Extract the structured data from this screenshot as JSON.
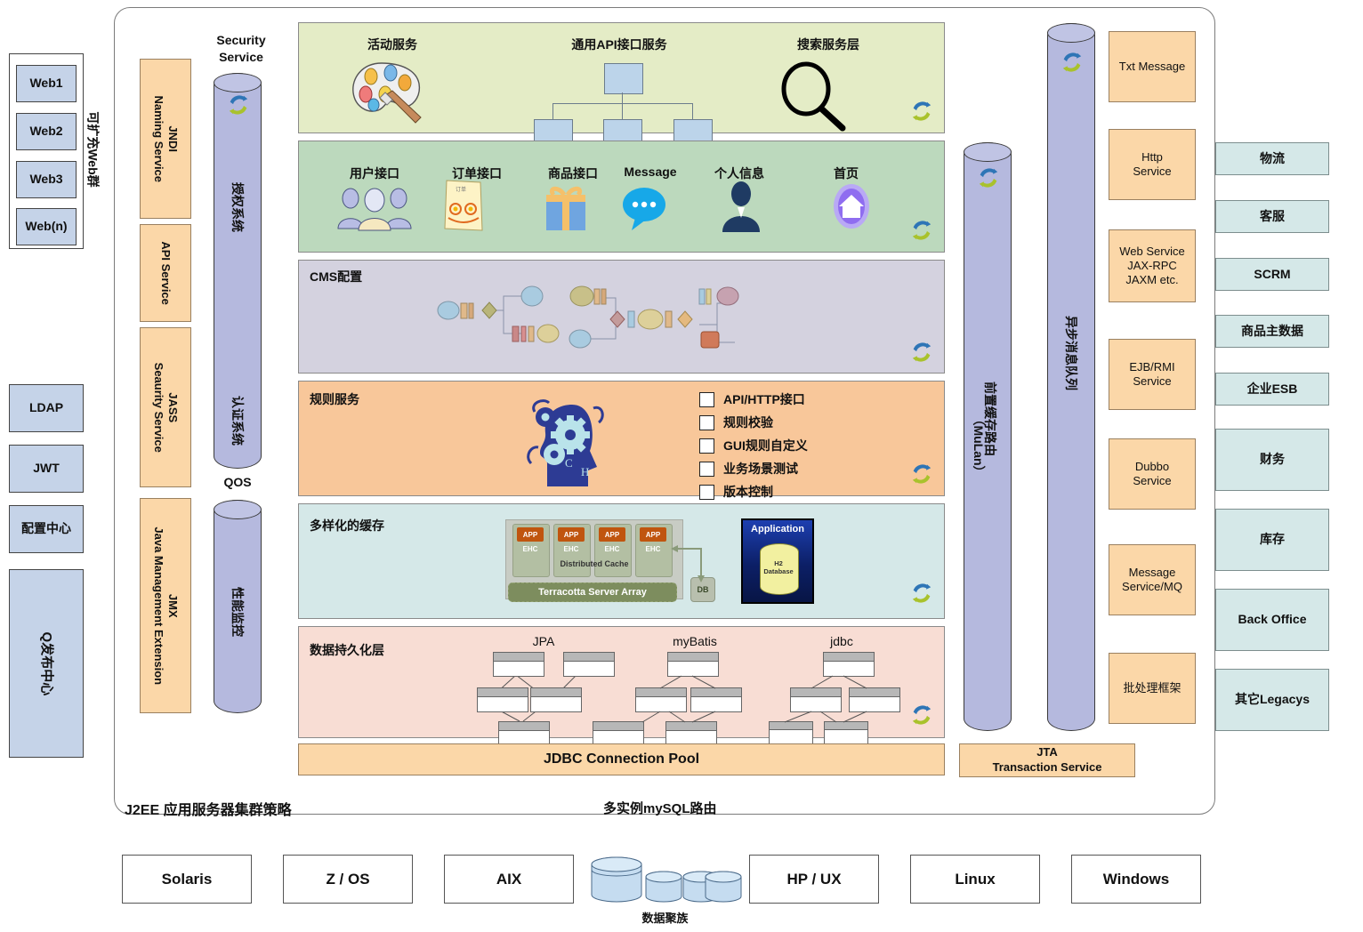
{
  "left_cluster": {
    "label_vertical": "可扩充Web群",
    "nodes": [
      "Web1",
      "Web2",
      "Web3",
      "Web(n)"
    ]
  },
  "left_support": {
    "items": [
      "LDAP",
      "JWT",
      "配置中心"
    ],
    "release_center": "Q发布中心"
  },
  "service_column": {
    "items": [
      {
        "abbr": "JNDI",
        "name": "Naming Service"
      },
      {
        "abbr": "",
        "name": "API Service"
      },
      {
        "abbr": "JASS",
        "name": "Seaurity Service"
      },
      {
        "abbr": "JMX",
        "name": "Java Management Extension"
      }
    ]
  },
  "security_cylinder": {
    "top_label_line1": "Security",
    "top_label_line2": "Service",
    "section_top": "授权系统",
    "section_bottom": "认证系统",
    "bottom_label": "QOS",
    "monitor_label": "性能监控"
  },
  "panels": [
    {
      "id": "activity",
      "title": "",
      "color": "#e4ecc6",
      "heads": [
        "活动服务",
        "通用API接口服务",
        "搜索服务层"
      ]
    },
    {
      "id": "interface",
      "title": "",
      "color": "#bcd9bd",
      "heads": [
        "用户接口",
        "订单接口",
        "商品接口",
        "Message",
        "个人信息",
        "首页"
      ]
    },
    {
      "id": "cms",
      "title": "CMS配置",
      "color": "#d4d2df",
      "heads": []
    },
    {
      "id": "rules",
      "title": "规则服务",
      "color": "#f8c79a",
      "checklist": [
        "API/HTTP接口",
        "规则校验",
        "GUI规则自定义",
        "业务场景测试",
        "版本控制"
      ]
    },
    {
      "id": "cache",
      "title": "多样化的缓存",
      "color": "#d5e8e8",
      "cache_diagram": {
        "app_label": "APP",
        "ehc_label": "EHC",
        "distributed_cache": "Distributed Cache",
        "server_array": "Terracotta Server Array",
        "db": "DB",
        "application": "Application",
        "h2_line1": "H2",
        "h2_line2": "Database"
      }
    },
    {
      "id": "persistence",
      "title": "数据持久化层",
      "color": "#f8ddd4",
      "heads": [
        "JPA",
        "myBatis",
        "jdbc"
      ]
    }
  ],
  "jdbc_pool": "JDBC Connection Pool",
  "jta": {
    "line1": "JTA",
    "line2": "Transaction Service"
  },
  "cache_route_cylinder": {
    "line1": "前置缓存路由",
    "line2": "（MuLan）"
  },
  "mq_cylinder": "异步消息队列",
  "integration_column": [
    "Txt Message",
    "Http\nService",
    "Web Service\nJAX-RPC\nJAXM etc.",
    "EJB/RMI\nService",
    "Dubbo\nService",
    "Message\nService/MQ",
    "批处理框架"
  ],
  "external_systems": [
    "物流",
    "客服",
    "SCRM",
    "商品主数据",
    "企业ESB",
    "财务",
    "库存",
    "Back Office",
    "其它Legacys"
  ],
  "footer": {
    "left": "J2EE 应用服务器集群策略",
    "center": "多实例mySQL路由"
  },
  "os_row": [
    "Solaris",
    "Z / OS",
    "AIX",
    "HP / UX",
    "Linux",
    "Windows"
  ],
  "db_cluster_label": "数据聚族",
  "colors": {
    "cylinder": "#b5b9de",
    "orange": "#fbd7a8",
    "blue": "#c5d3e8",
    "teal": "#d5e8e8",
    "sync_blue": "#2e75b6",
    "sync_green": "#a9c22c"
  }
}
